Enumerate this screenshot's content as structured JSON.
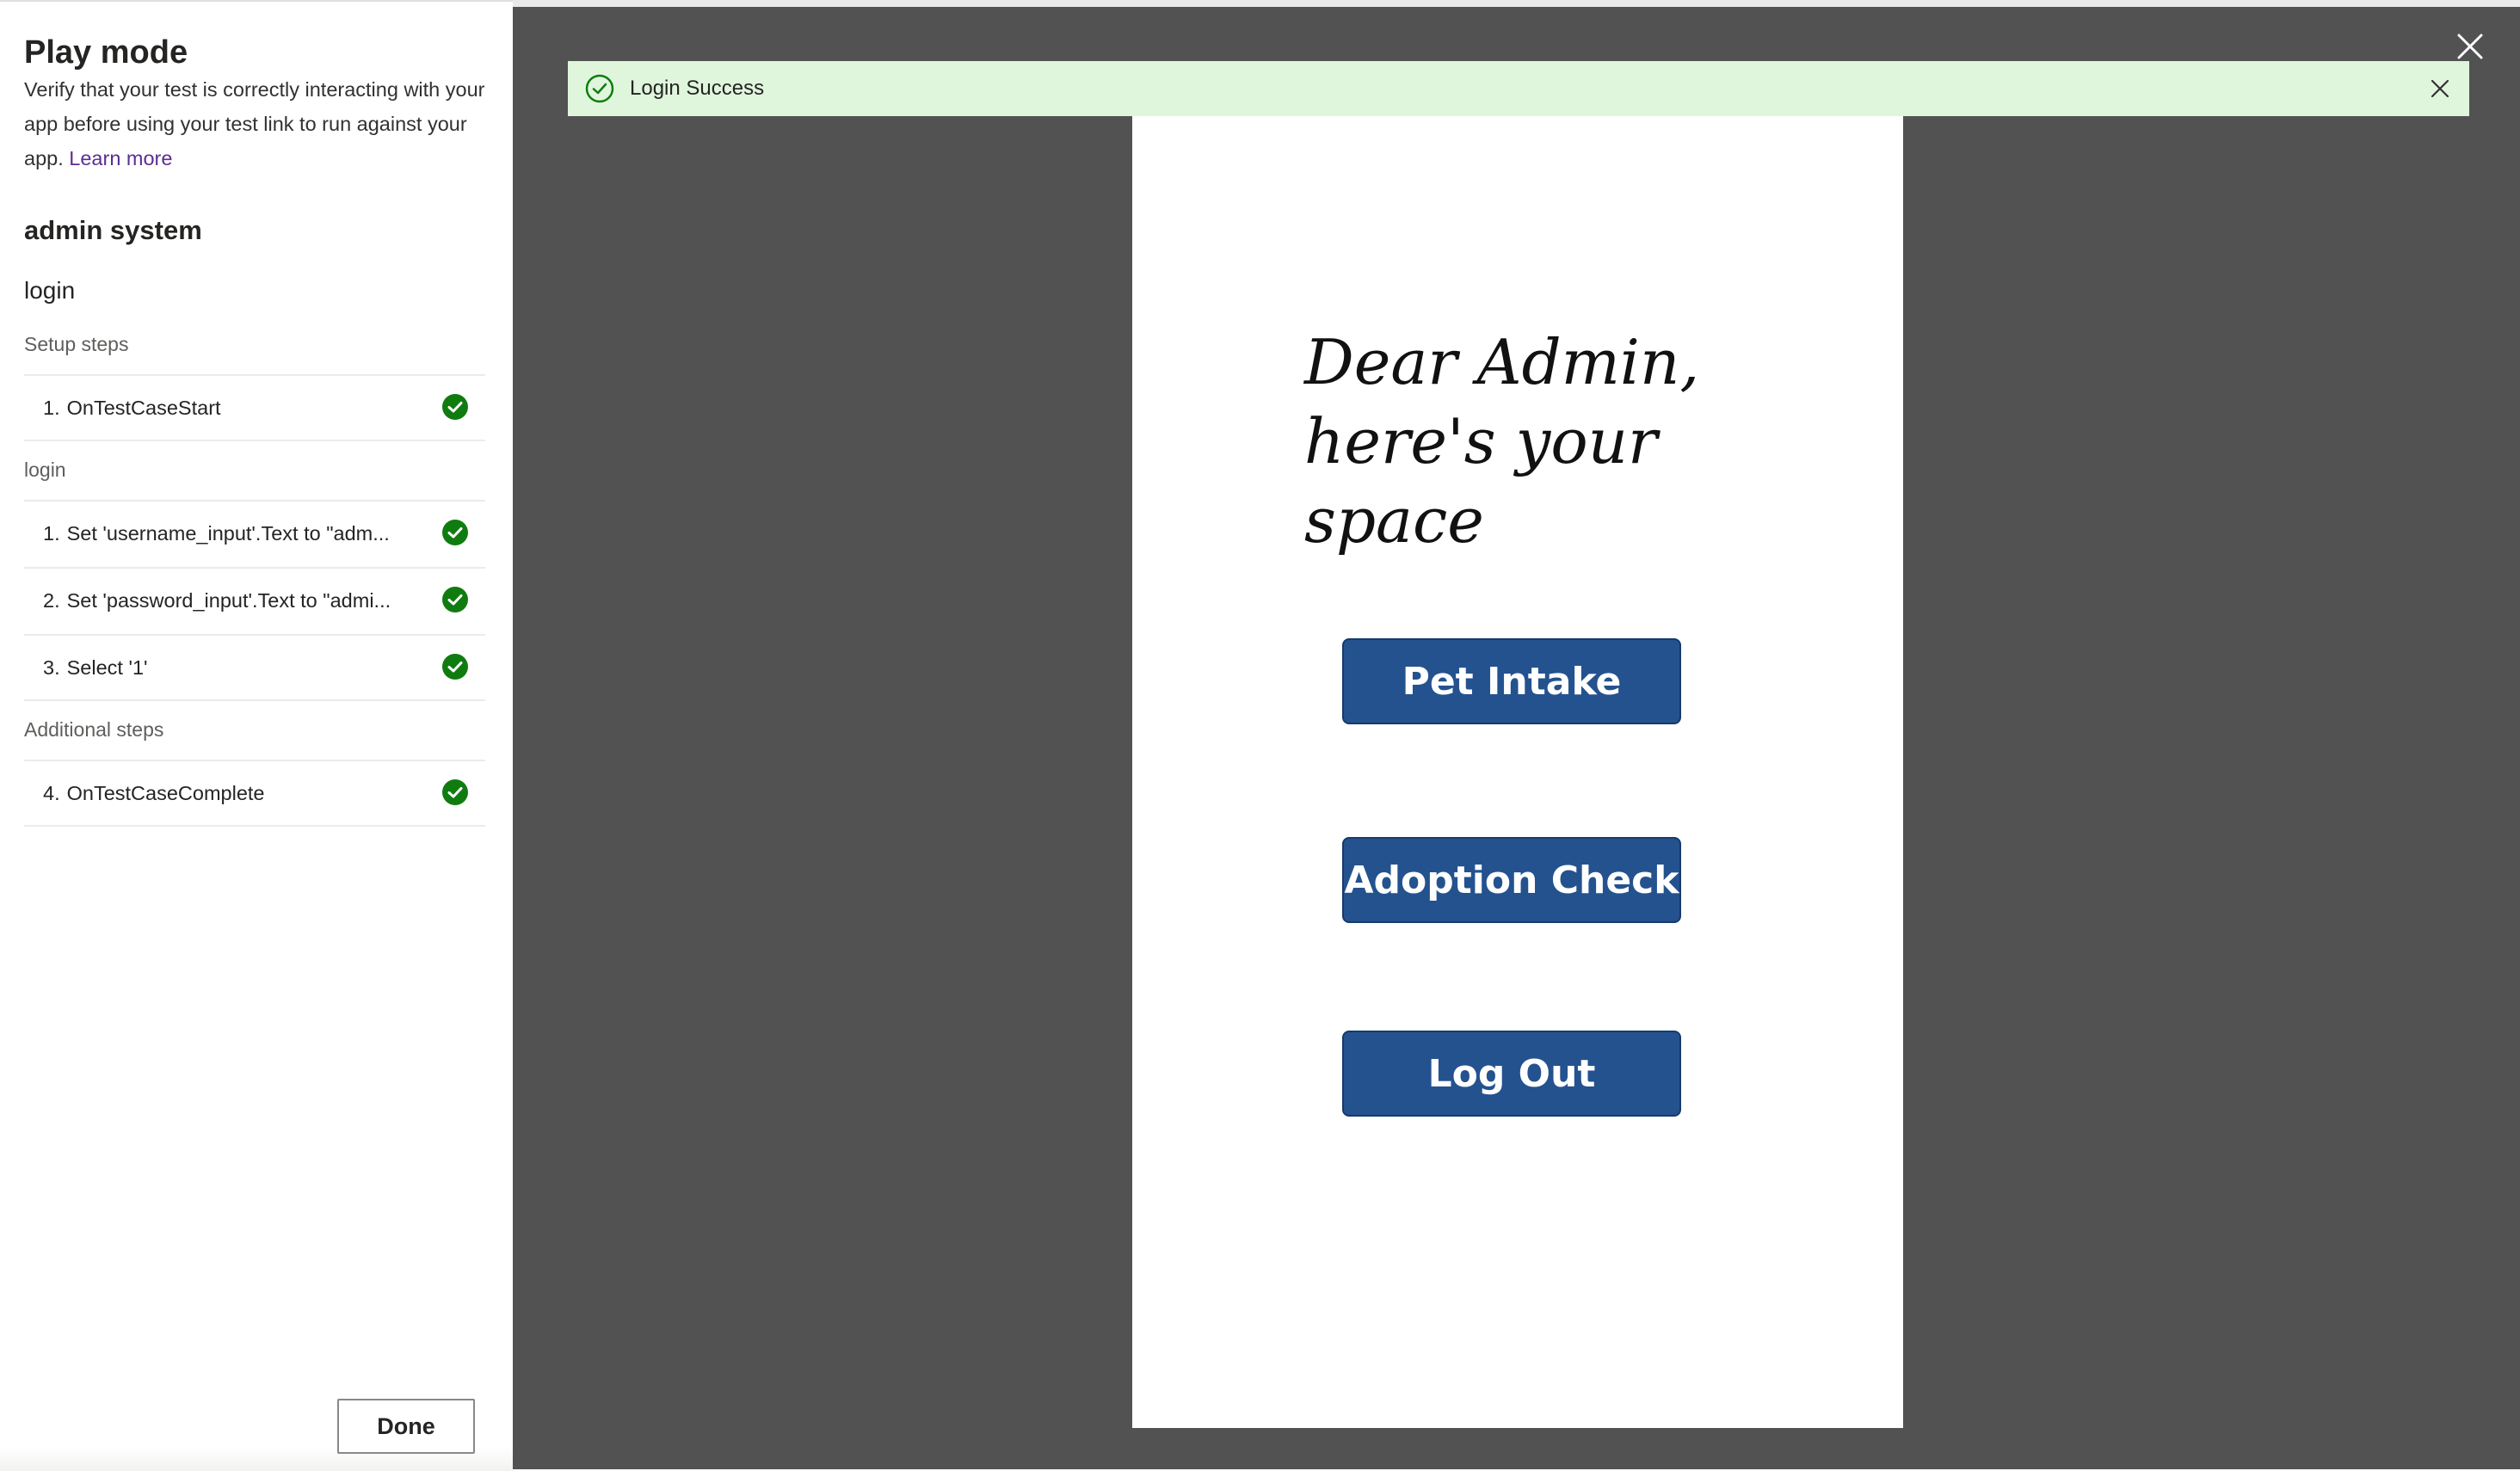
{
  "panel": {
    "title": "Play mode",
    "description": "Verify that your test is correctly interacting with your app before using your test link to run against your app.",
    "learn_more": "Learn more",
    "suite_name": "admin system",
    "case_name": "login",
    "sections": [
      {
        "label": "Setup steps",
        "steps": [
          {
            "num": "1.",
            "text": "OnTestCaseStart",
            "status": "passed"
          }
        ]
      },
      {
        "label": "login",
        "steps": [
          {
            "num": "1.",
            "text": "Set 'username_input'.Text to \"adm...",
            "status": "passed"
          },
          {
            "num": "2.",
            "text": "Set 'password_input'.Text to \"admi...",
            "status": "passed"
          },
          {
            "num": "3.",
            "text": "Select '1'",
            "status": "passed"
          }
        ]
      },
      {
        "label": "Additional steps",
        "steps": [
          {
            "num": "4.",
            "text": "OnTestCaseComplete",
            "status": "passed"
          }
        ]
      }
    ],
    "done_label": "Done"
  },
  "notice": {
    "text": "Login Success",
    "icon": "check-circle-icon"
  },
  "app": {
    "greeting_line1": "Dear Admin,",
    "greeting_line2": "here's your space",
    "buttons": {
      "pet_intake": "Pet Intake",
      "adoption_check": "Adoption Check",
      "log_out": "Log Out"
    }
  },
  "colors": {
    "success_green": "#107c10",
    "notice_bg": "#dff6dd",
    "app_button": "#24528f",
    "stage_bg": "#525252",
    "link": "#5c2d91"
  }
}
